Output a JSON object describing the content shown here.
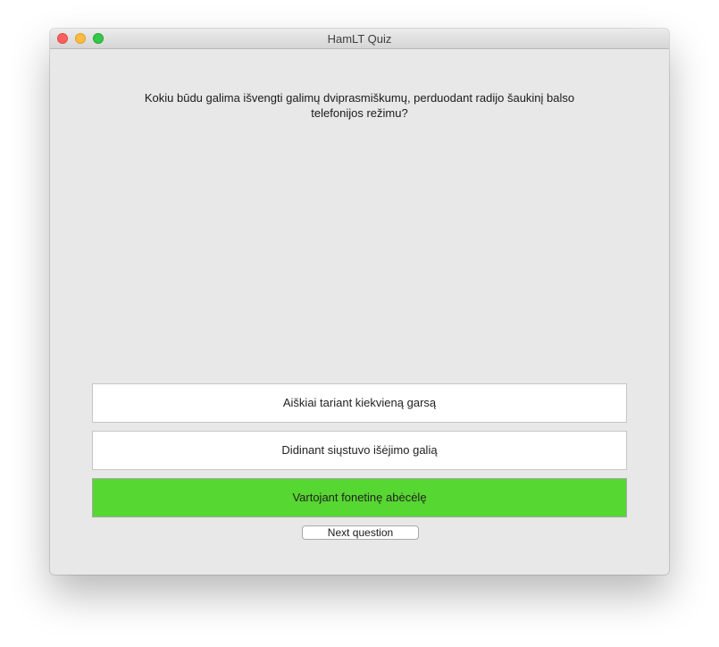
{
  "window": {
    "title": "HamLT Quiz"
  },
  "quiz": {
    "question": "Kokiu būdu galima išvengti galimų dviprasmiškumų, perduodant radijo šaukinį balso telefonijos režimu?",
    "answers": [
      {
        "label": "Aiškiai tariant kiekvieną garsą",
        "state": "default"
      },
      {
        "label": "Didinant siųstuvo išėjimo galią",
        "state": "default"
      },
      {
        "label": "Vartojant fonetinę abėcėlę",
        "state": "correct"
      }
    ],
    "next_label": "Next question"
  },
  "colors": {
    "correct": "#57d731",
    "window_bg": "#e8e8e8"
  }
}
